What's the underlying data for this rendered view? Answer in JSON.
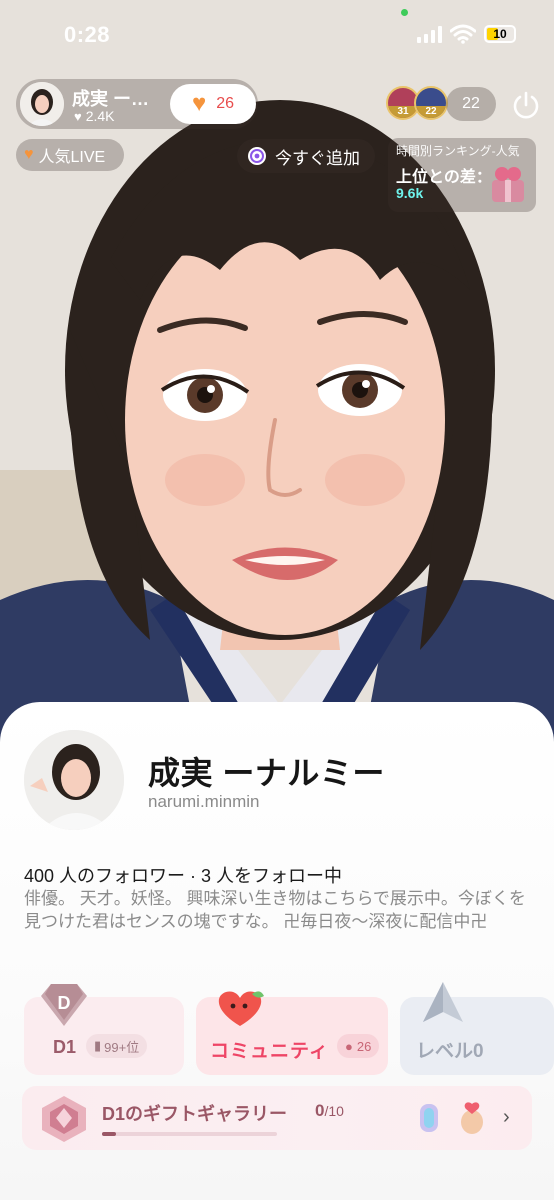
{
  "status_bar": {
    "time": "0:28",
    "battery": "10"
  },
  "host": {
    "name": "成実 ー…",
    "likes": "2.4K",
    "follow_count": "26"
  },
  "viewers": {
    "badges": [
      "31",
      "22"
    ],
    "count": "22"
  },
  "chips": {
    "popular": "人気LIVE",
    "add_now": "今すぐ追加"
  },
  "ranking": {
    "title": "時間別ランキング-人気",
    "gap_label": "上位との差：",
    "gap_value": "9.6k"
  },
  "profile": {
    "name": "成実 ーナルミー",
    "handle": "narumi.minmin",
    "follow_stats": "400 人のフォロワー · 3 人をフォロー中",
    "bio": "俳優。 天才。妖怪。 興味深い生き物はこちらで展示中。今ぼくを見つけた君はセンスの塊ですな。 卍毎日夜〜深夜に配信中卍"
  },
  "cards": {
    "d1": {
      "badge_letter": "D",
      "label": "D1",
      "rank": "99+位"
    },
    "community": {
      "label": "コミュニティ",
      "count": "26"
    },
    "level": {
      "label": "レベル0"
    }
  },
  "gallery": {
    "title": "D1のギフトギャラリー",
    "current": "0",
    "total": "/10",
    "progress_fraction": 0.08
  },
  "colors": {
    "accent_pink": "#ee4566",
    "gift_brown": "#9a5766",
    "ranking_value": "#6ff3ec"
  }
}
